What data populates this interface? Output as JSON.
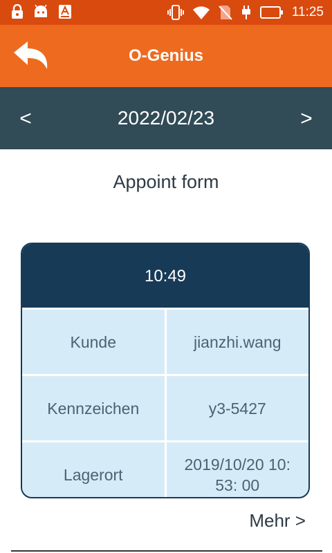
{
  "status_bar": {
    "time": "11:25",
    "left_icons": [
      "lock-icon",
      "android-icon",
      "font-icon"
    ],
    "right_icons": [
      "vibrate-icon",
      "wifi-icon",
      "no-sim-icon",
      "charging-icon",
      "battery-icon"
    ]
  },
  "app_bar": {
    "title": "O-Genius",
    "back_icon": "back-arrow-icon"
  },
  "date_nav": {
    "prev": "<",
    "date": "2022/02/23",
    "next": ">"
  },
  "form": {
    "title": "Appoint form"
  },
  "card": {
    "time": "10:49",
    "rows": [
      {
        "label": "Kunde",
        "value": "jianzhi.wang"
      },
      {
        "label": "Kennzeichen",
        "value": "y3-5427"
      },
      {
        "label": "Lagerort",
        "value": "2019/10/20 10: 53: 00"
      }
    ]
  },
  "more": {
    "label": "Mehr >"
  },
  "colors": {
    "status_bar": "#d94a0f",
    "app_bar": "#ee6a1f",
    "date_bar": "#314b57",
    "card_header": "#173a57",
    "card_body": "#d6ebf8"
  }
}
